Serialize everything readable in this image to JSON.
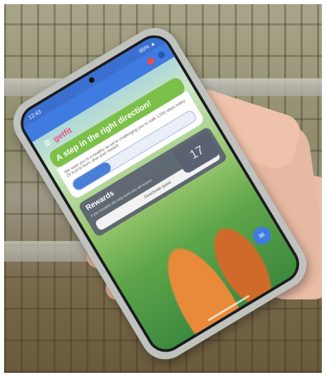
{
  "app": {
    "brand": "getfit",
    "status_time": "12:43",
    "status_right": "65% ▲"
  },
  "quest": {
    "title": "A step in the right direction!",
    "body": "We want you to a healthy as we're challenging you to walk 1,000 steps today. 25 kcal to burn, plus your reward.",
    "progress": 0.3,
    "steps_count": "17"
  },
  "rewards": {
    "title": "Rewards",
    "body": "If you complete this step quest you will receive",
    "button_label": "Deactivate quest"
  },
  "colors": {
    "appbar": "#3f7be0",
    "card_green": "#7cc04a",
    "rewards_bg": "#5a6170"
  },
  "icons": [
    "menu-icon",
    "notification-icon",
    "profile-icon",
    "fab-chat-icon"
  ]
}
